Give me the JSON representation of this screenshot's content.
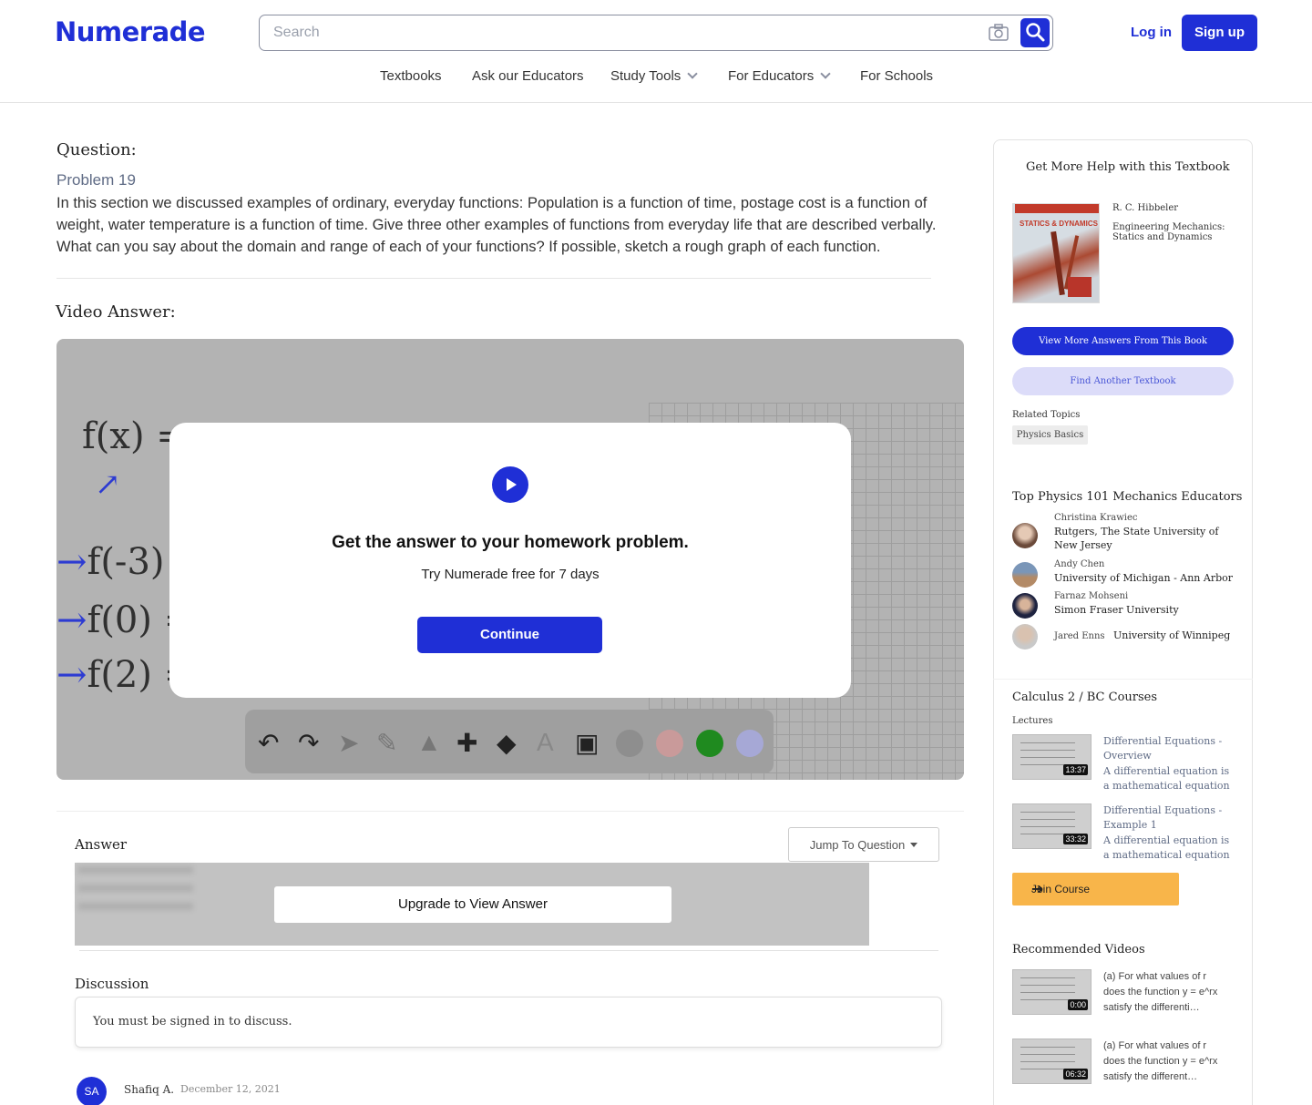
{
  "header": {
    "logo": "Numerade",
    "search_placeholder": "Search",
    "login": "Log in",
    "signup": "Sign up",
    "nav": [
      {
        "label": "Textbooks"
      },
      {
        "label": "Ask our Educators"
      },
      {
        "label": "Study Tools"
      },
      {
        "label": "For Educators"
      },
      {
        "label": "For Schools"
      }
    ]
  },
  "question": {
    "heading": "Question:",
    "problem": "Problem 19",
    "text": "In this section we discussed examples of ordinary, everyday functions: Population is a function of time, postage cost is a function of weight, water temperature is a function of time. Give three other examples of functions from everyday life that are described verbally. What can you say about the domain and range of each of your functions? If possible, sketch a rough graph of each function."
  },
  "video": {
    "heading": "Video Answer:",
    "handwriting": [
      "f(x) =",
      "f(-3) =",
      "f(0) =",
      "f(2) ="
    ],
    "modal": {
      "headline": "Get the answer to your homework problem.",
      "sub": "Try Numerade free for 7 days",
      "button": "Continue"
    }
  },
  "answer": {
    "label": "Answer",
    "jump": "Jump To Question",
    "upgrade": "Upgrade to View Answer"
  },
  "discussion": {
    "label": "Discussion",
    "notice": "You must be signed in to discuss.",
    "comment": {
      "initials": "SA",
      "user": "Shafiq A.",
      "date": "December 12, 2021"
    }
  },
  "sidebar": {
    "help_title": "Get More Help with this Textbook",
    "book": {
      "author": "R. C. Hibbeler",
      "title": "Engineering Mechanics: Statics and Dynamics",
      "cover_text": "STATICS & DYNAMICS"
    },
    "view_more": "View More Answers From This Book",
    "find_another": "Find Another Textbook",
    "related_label": "Related Topics",
    "related_topic": "Physics Basics",
    "educators_title": "Top Physics 101 Mechanics Educators",
    "educators": [
      {
        "name": "Christina Krawiec",
        "school": "Rutgers, The State University of New Jersey"
      },
      {
        "name": "Andy Chen",
        "school": "University of Michigan - Ann Arbor"
      },
      {
        "name": "Farnaz Mohseni",
        "school": "Simon Fraser University"
      },
      {
        "name": "Jared Enns",
        "school": "University of Winnipeg"
      }
    ],
    "course_title": "Calculus 2 / BC Courses",
    "lectures_label": "Lectures",
    "lectures": [
      {
        "title": "Differential Equations - Overview",
        "desc": "A differential equation is a mathematical equation",
        "duration": "13:37"
      },
      {
        "title": "Differential Equations - Example 1",
        "desc": "A differential equation is a mathematical equation",
        "duration": "33:32"
      }
    ],
    "join": "Join Course",
    "recommended_title": "Recommended Videos",
    "recommended": [
      {
        "line1": "(a) For what values of r",
        "line2": "does the function y = e^rx",
        "line3": "satisfy the differenti…",
        "duration": "0:00"
      },
      {
        "line1": "(a) For what values of r",
        "line2": "does the function y = e^rx",
        "line3": "satisfy the different…",
        "duration": "06:32"
      }
    ]
  },
  "colors": {
    "brand": "#1f2fd6",
    "join": "#f8b54a"
  }
}
